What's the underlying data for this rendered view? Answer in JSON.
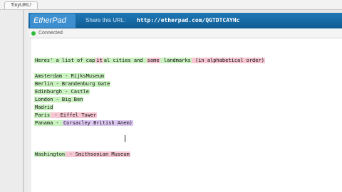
{
  "browser": {
    "tab_title": "TinyURL!"
  },
  "header": {
    "logo": "EtherPad",
    "share_label": "Share this URL:",
    "share_url": "http://etherpad.com/QGTDTCAYHc"
  },
  "status": {
    "text": "Connected"
  },
  "editor": {
    "lines": [
      {
        "segments": [
          {
            "text": "Heres' a list of cap",
            "color": "g"
          },
          {
            "text": "it",
            "color": "p"
          },
          {
            "text": "al cities and ",
            "color": "g"
          },
          {
            "text": "some",
            "color": "p"
          },
          {
            "text": " landmarks",
            "color": "g"
          },
          {
            "text": " (in alphabetical order)",
            "color": "p"
          }
        ]
      },
      {
        "segments": []
      },
      {
        "segments": [
          {
            "text": "Amsterdam - RijksMuseum",
            "color": "g"
          }
        ]
      },
      {
        "segments": [
          {
            "text": "Berlin - Brandenburg Gate",
            "color": "g"
          }
        ]
      },
      {
        "segments": [
          {
            "text": "Edinburgh - Castle",
            "color": "g"
          }
        ]
      },
      {
        "segments": [
          {
            "text": "London - Big Ben",
            "color": "g"
          }
        ]
      },
      {
        "segments": [
          {
            "text": "Madrid",
            "color": "g"
          }
        ]
      },
      {
        "segments": [
          {
            "text": "Paris",
            "color": "g"
          },
          {
            "text": " - Eiffel Tower",
            "color": "p"
          }
        ]
      },
      {
        "segments": [
          {
            "text": "Panama - ",
            "color": "g"
          },
          {
            "text": "Corsacley British Anem)",
            "color": "v"
          }
        ]
      },
      {
        "segments": []
      },
      {
        "segments": []
      },
      {
        "segments": []
      },
      {
        "segments": [
          {
            "text": "Washington",
            "color": "g"
          },
          {
            "text": " - Smithsonian Museum",
            "color": "p"
          }
        ]
      }
    ]
  }
}
